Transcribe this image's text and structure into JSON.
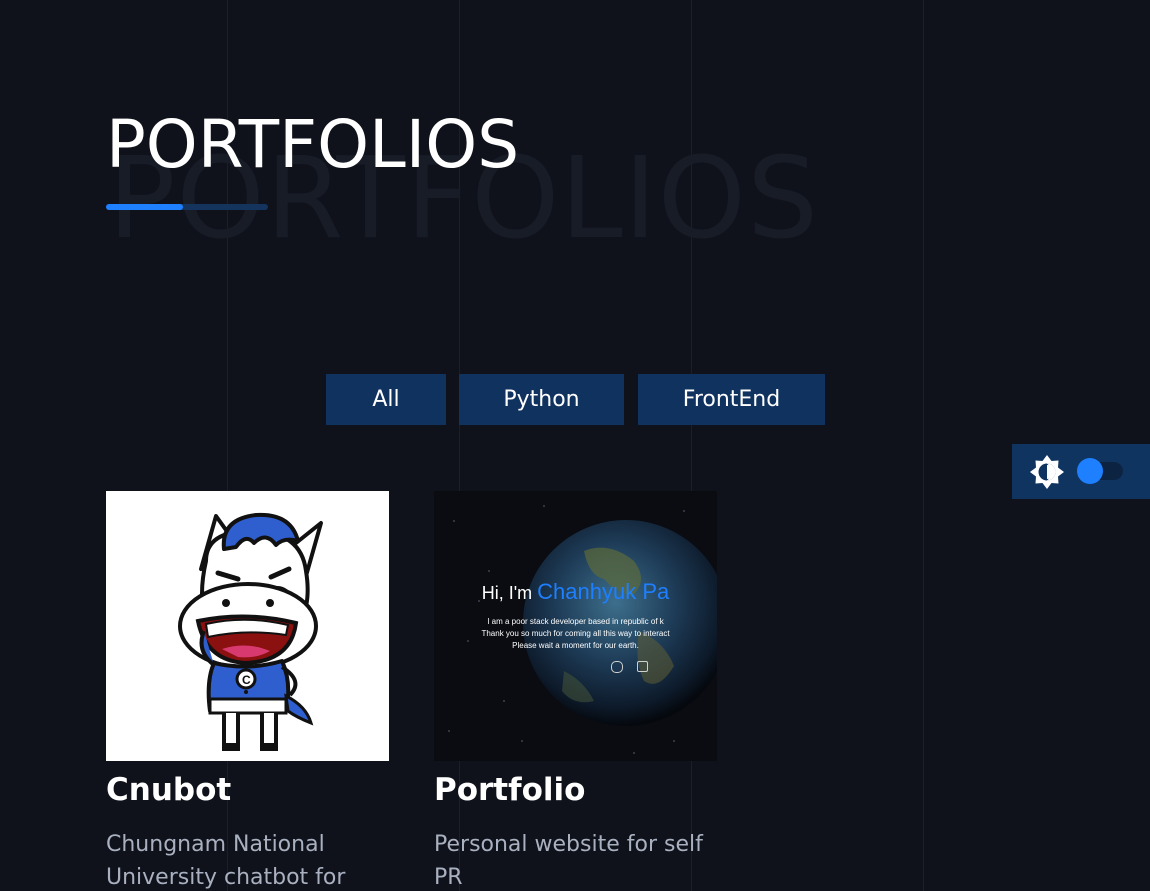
{
  "section": {
    "title": "PORTFOLIOS",
    "title_ghost": "PORTFOLIOS"
  },
  "filters": [
    {
      "label": "All"
    },
    {
      "label": "Python"
    },
    {
      "label": "FrontEnd"
    }
  ],
  "theme_toggle": {
    "icon": "brightness-icon",
    "state": "off"
  },
  "portfolios": [
    {
      "title": "Cnubot",
      "description": "Chungnam National University chatbot for",
      "image": "cnubot-mascot-image"
    },
    {
      "title": "Portfolio",
      "description": "Personal website for self PR",
      "image": "portfolio-earth-screenshot",
      "preview": {
        "greeting": "Hi, I'm",
        "name": "Chanhyuk Pa",
        "line1": "I am a poor stack developer based in republic of k",
        "line2": "Thank you so much for coming all this way to interact",
        "line3": "Please wait a moment for our earth."
      }
    }
  ],
  "colors": {
    "background": "#0f121b",
    "accent": "#1e7fff",
    "button_bg": "#10325f",
    "muted_text": "#a9b0c0"
  }
}
